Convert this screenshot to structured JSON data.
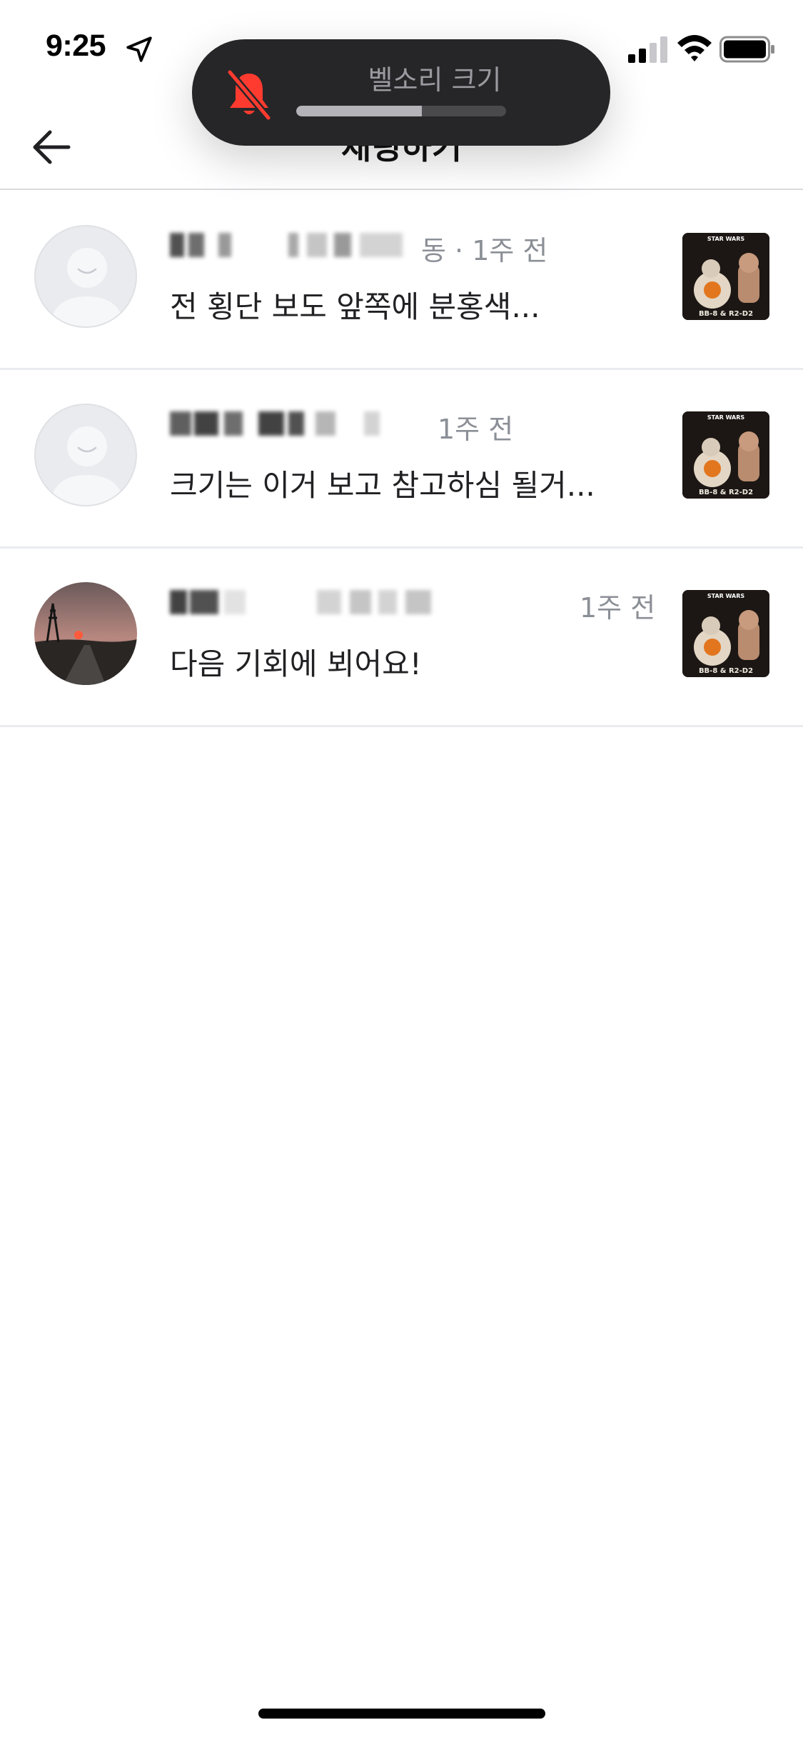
{
  "status_bar": {
    "time": "9:25"
  },
  "header": {
    "title": "채팅하기"
  },
  "volume_hud": {
    "label": "벨소리 크기",
    "level": 0.6
  },
  "chats": [
    {
      "meta": "동 · 1주 전",
      "message": "전 횡단 보도 앞쪽에 분홍색...",
      "avatar": "default"
    },
    {
      "meta": "1주 전",
      "message": "크기는 이거 보고 참고하심 될거...",
      "avatar": "default"
    },
    {
      "meta": "1주 전",
      "message": "다음 기회에 뵈어요!",
      "avatar": "photo"
    }
  ],
  "thumbnail": {
    "brand": "STAR WARS",
    "caption": "BB-8 & R2-D2"
  }
}
